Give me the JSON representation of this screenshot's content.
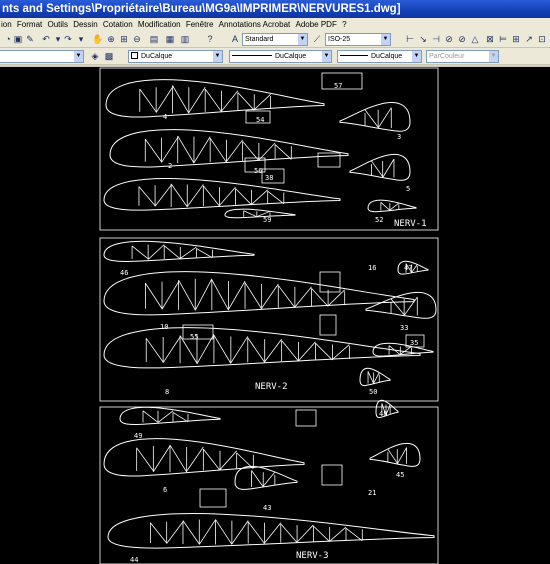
{
  "window": {
    "title": "nts and Settings\\Propriétaire\\Bureau\\MG9a\\IMPRIMER\\NERVURES1.dwg]"
  },
  "menu": {
    "items": [
      "ion",
      "Format",
      "Outils",
      "Dessin",
      "Cotation",
      "Modification",
      "Fenêtre",
      "Annotations Acrobat",
      "Adobe PDF",
      "?"
    ]
  },
  "toolbar1": {
    "text_style": "Standard",
    "dim_style": "ISO-25"
  },
  "toolbar2": {
    "layer_color": "DuCalque",
    "linetype": "DuCalque",
    "lineweight": "DuCalque",
    "plot_style": "ParCouleur"
  },
  "drawing": {
    "sheets": [
      {
        "label": "NERV-1",
        "numbers": [
          "57",
          "4",
          "54",
          "3",
          "56",
          "38",
          "2",
          "5",
          "59",
          "52"
        ]
      },
      {
        "label": "NERV-2",
        "numbers": [
          "46",
          "16",
          "47",
          "10",
          "55",
          "33",
          "35",
          "8",
          "50"
        ]
      },
      {
        "label": "NERV-3",
        "numbers": [
          "49",
          "48",
          "6",
          "45",
          "43",
          "21",
          "44"
        ]
      }
    ]
  }
}
